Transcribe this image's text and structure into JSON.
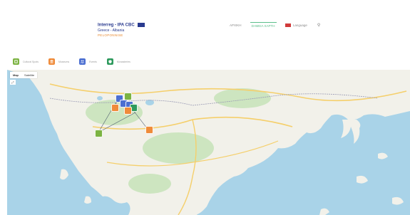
{
  "header": {
    "brand_line1": "Interreg - IPA CBC",
    "brand_line2": "Greece - Albania",
    "brand_line3": "PELOPONNISE",
    "nav": [
      {
        "label": "ΑΡΧΙΚΗ",
        "active": false
      },
      {
        "label": "ΣΗΜΕΙΑ ΧΑΡΤΗ",
        "active": true
      },
      {
        "label": "Language",
        "active": false
      }
    ]
  },
  "legend": [
    {
      "label": "Cultural Spots",
      "color": "#7cb342",
      "icon": "square-icon"
    },
    {
      "label": "Museums",
      "color": "#ef8b3a",
      "icon": "building-icon"
    },
    {
      "label": "Events",
      "color": "#4c6fd1",
      "icon": "people-icon"
    },
    {
      "label": "Monasteries",
      "color": "#2e9a5d",
      "icon": "shield-icon"
    }
  ],
  "map": {
    "toggle": [
      "Map",
      "Satellite"
    ],
    "fullscreen": "⤢"
  },
  "colors": {
    "land": "#f2f1ea",
    "water": "#a9d3e8",
    "roads": "#f5cf6b",
    "green": "#cde5c0"
  }
}
